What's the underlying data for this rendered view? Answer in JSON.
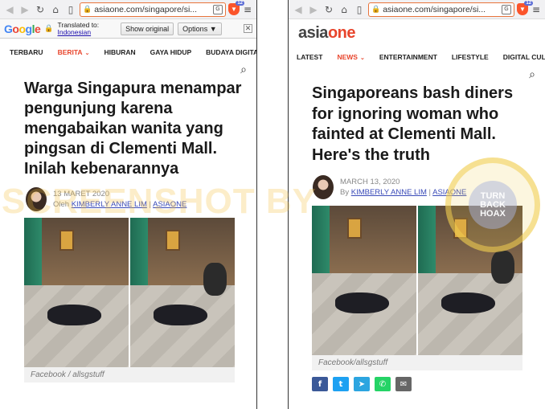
{
  "browser_left": {
    "url": "asiaone.com/singapore/si..."
  },
  "browser_right": {
    "url": "asiaone.com/singapore/si..."
  },
  "browser": {
    "shield_count": "12",
    "menu_icon": "hamburger-menu-icon"
  },
  "translate_bar": {
    "translated_to_label": "Translated to:",
    "language": "Indonesian",
    "show_original_label": "Show original",
    "options_label": "Options ▼",
    "close_label": "✕"
  },
  "site": {
    "logo_asia": "asia",
    "logo_one": "one"
  },
  "nav_left": [
    {
      "label": "TERBARU"
    },
    {
      "label": "BERITA",
      "active": true
    },
    {
      "label": "HIBURAN"
    },
    {
      "label": "GAYA HIDUP"
    },
    {
      "label": "BUDAYA DIGITAL"
    }
  ],
  "nav_right": [
    {
      "label": "LATEST"
    },
    {
      "label": "NEWS",
      "active": true
    },
    {
      "label": "ENTERTAINMENT"
    },
    {
      "label": "LIFESTYLE"
    },
    {
      "label": "DIGITAL CULTUR"
    }
  ],
  "article_left": {
    "headline": "Warga Singapura menampar pengunjung karena mengabaikan wanita yang pingsan di Clementi Mall. Inilah kebenarannya",
    "date": "13 MARET 2020",
    "by_prefix": "Oleh",
    "author": "KIMBERLY ANNE LIM",
    "separator": "|",
    "source": "ASIAONE",
    "caption": "Facebook / allsgstuff"
  },
  "article_right": {
    "headline": "Singaporeans bash diners for ignoring woman who fainted at Clementi Mall. Here's the truth",
    "date": "MARCH 13, 2020",
    "by_prefix": "By",
    "author": "KIMBERLY ANNE LIM",
    "separator": "|",
    "source": "ASIAONE",
    "caption": "Facebook/allsgstuff"
  },
  "share_buttons": [
    {
      "icon": "facebook-icon",
      "glyph": "f",
      "color": "#3b5998"
    },
    {
      "icon": "twitter-icon",
      "glyph": "t",
      "color": "#1da1f2"
    },
    {
      "icon": "telegram-icon",
      "glyph": "➤",
      "color": "#2ca5e0"
    },
    {
      "icon": "whatsapp-icon",
      "glyph": "✆",
      "color": "#25d366"
    },
    {
      "icon": "email-icon",
      "glyph": "✉",
      "color": "#666666"
    }
  ],
  "watermark": {
    "text": "SCREENSHOT BY",
    "seal_text": "TURN BACK HOAX"
  }
}
